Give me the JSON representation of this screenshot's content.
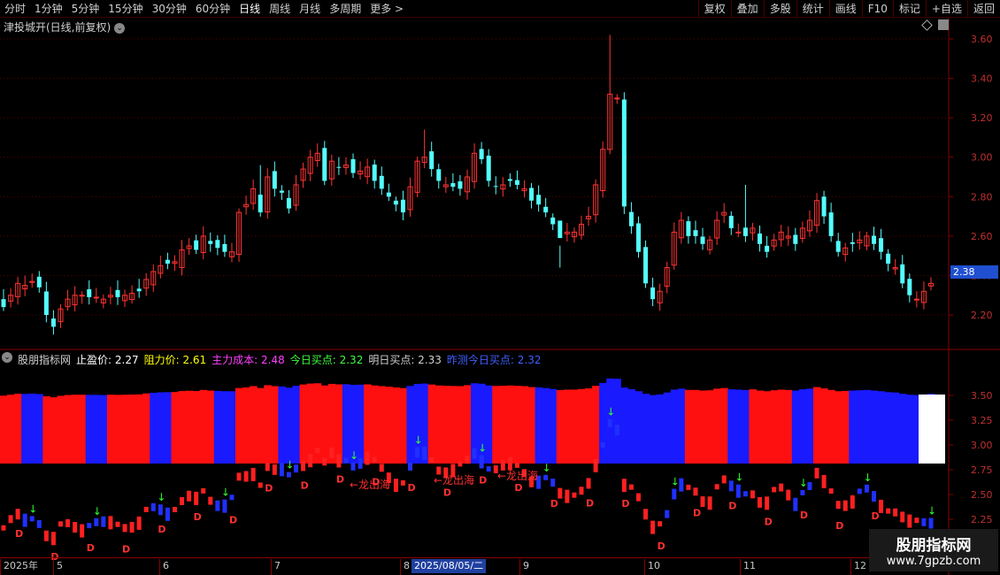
{
  "toolbar": {
    "periods": [
      "分时",
      "1分钟",
      "5分钟",
      "15分钟",
      "30分钟",
      "60分钟",
      "日线",
      "周线",
      "月线",
      "多周期",
      "更多 >"
    ],
    "active_period": "日线",
    "right_buttons": [
      "复权",
      "叠加",
      "多股",
      "统计",
      "画线",
      "F10",
      "标记",
      "+自选",
      "返回"
    ]
  },
  "main_chart": {
    "title": "津投城开(日线,前复权)",
    "current_price": "2.38",
    "price_axis": [
      "3.60",
      "3.40",
      "3.20",
      "3.00",
      "2.80",
      "2.60",
      "2.40",
      "2.20"
    ]
  },
  "indicator": {
    "name": "股朋指标网",
    "items": [
      {
        "label": "止盈价: 2.27",
        "color": "#ffffff"
      },
      {
        "label": "阻力价: 2.61",
        "color": "#ffff00"
      },
      {
        "label": "主力成本: 2.48",
        "color": "#ff40ff"
      },
      {
        "label": "今日买点: 2.32",
        "color": "#40ff40"
      },
      {
        "label": "明日买点: 2.33",
        "color": "#d0d0d0"
      },
      {
        "label": "昨测今日买点: 2.32",
        "color": "#4060ff"
      }
    ],
    "axis": [
      "3.50",
      "3.25",
      "3.00",
      "2.75",
      "2.50",
      "2.25"
    ],
    "annotations": [
      "←龙出海",
      "←龙出海",
      "←龙出海"
    ]
  },
  "date_axis": {
    "ticks": [
      "2025年",
      "5",
      "6",
      "7",
      "8",
      "9",
      "10",
      "11",
      "12"
    ],
    "highlight": "2025/08/05/二"
  },
  "watermark": {
    "title": "股朋指标网",
    "url": "www.7gpzb.com"
  },
  "chart_data": {
    "type": "candlestick",
    "title": "津投城开(日线,前复权)",
    "ylim": [
      2.1,
      3.68
    ],
    "closes": [
      2.24,
      2.3,
      2.36,
      2.35,
      2.37,
      2.34,
      2.2,
      2.14,
      2.23,
      2.28,
      2.3,
      2.3,
      2.29,
      2.29,
      2.28,
      2.3,
      2.29,
      2.3,
      2.31,
      2.32,
      2.38,
      2.42,
      2.45,
      2.46,
      2.47,
      2.53,
      2.55,
      2.53,
      2.6,
      2.56,
      2.54,
      2.52,
      2.52,
      2.72,
      2.76,
      2.84,
      2.72,
      2.9,
      2.84,
      2.82,
      2.74,
      2.86,
      2.94,
      3.0,
      3.02,
      2.88,
      2.98,
      2.95,
      2.96,
      2.92,
      2.93,
      2.95,
      2.88,
      2.84,
      2.8,
      2.76,
      2.72,
      2.85,
      2.98,
      3.0,
      2.94,
      2.88,
      2.86,
      2.85,
      2.84,
      2.9,
      3.02,
      2.99,
      2.88,
      2.85,
      2.86,
      2.88,
      2.86,
      2.84,
      2.78,
      2.76,
      2.72,
      2.66,
      2.59,
      2.62,
      2.62,
      2.66,
      2.7,
      2.86,
      3.04,
      3.32,
      3.3,
      2.75,
      2.65,
      2.52,
      2.36,
      2.28,
      2.32,
      2.44,
      2.62,
      2.68,
      2.6,
      2.6,
      2.56,
      2.58,
      2.68,
      2.72,
      2.64,
      2.62,
      2.6,
      2.64,
      2.56,
      2.52,
      2.58,
      2.62,
      2.6,
      2.56,
      2.64,
      2.68,
      2.78,
      2.7,
      2.6,
      2.52,
      2.54,
      2.56,
      2.58,
      2.6,
      2.56,
      2.52,
      2.46,
      2.44,
      2.36,
      2.3,
      2.28,
      2.32,
      2.36
    ],
    "candle_colors": "red=up, cyan=down"
  }
}
